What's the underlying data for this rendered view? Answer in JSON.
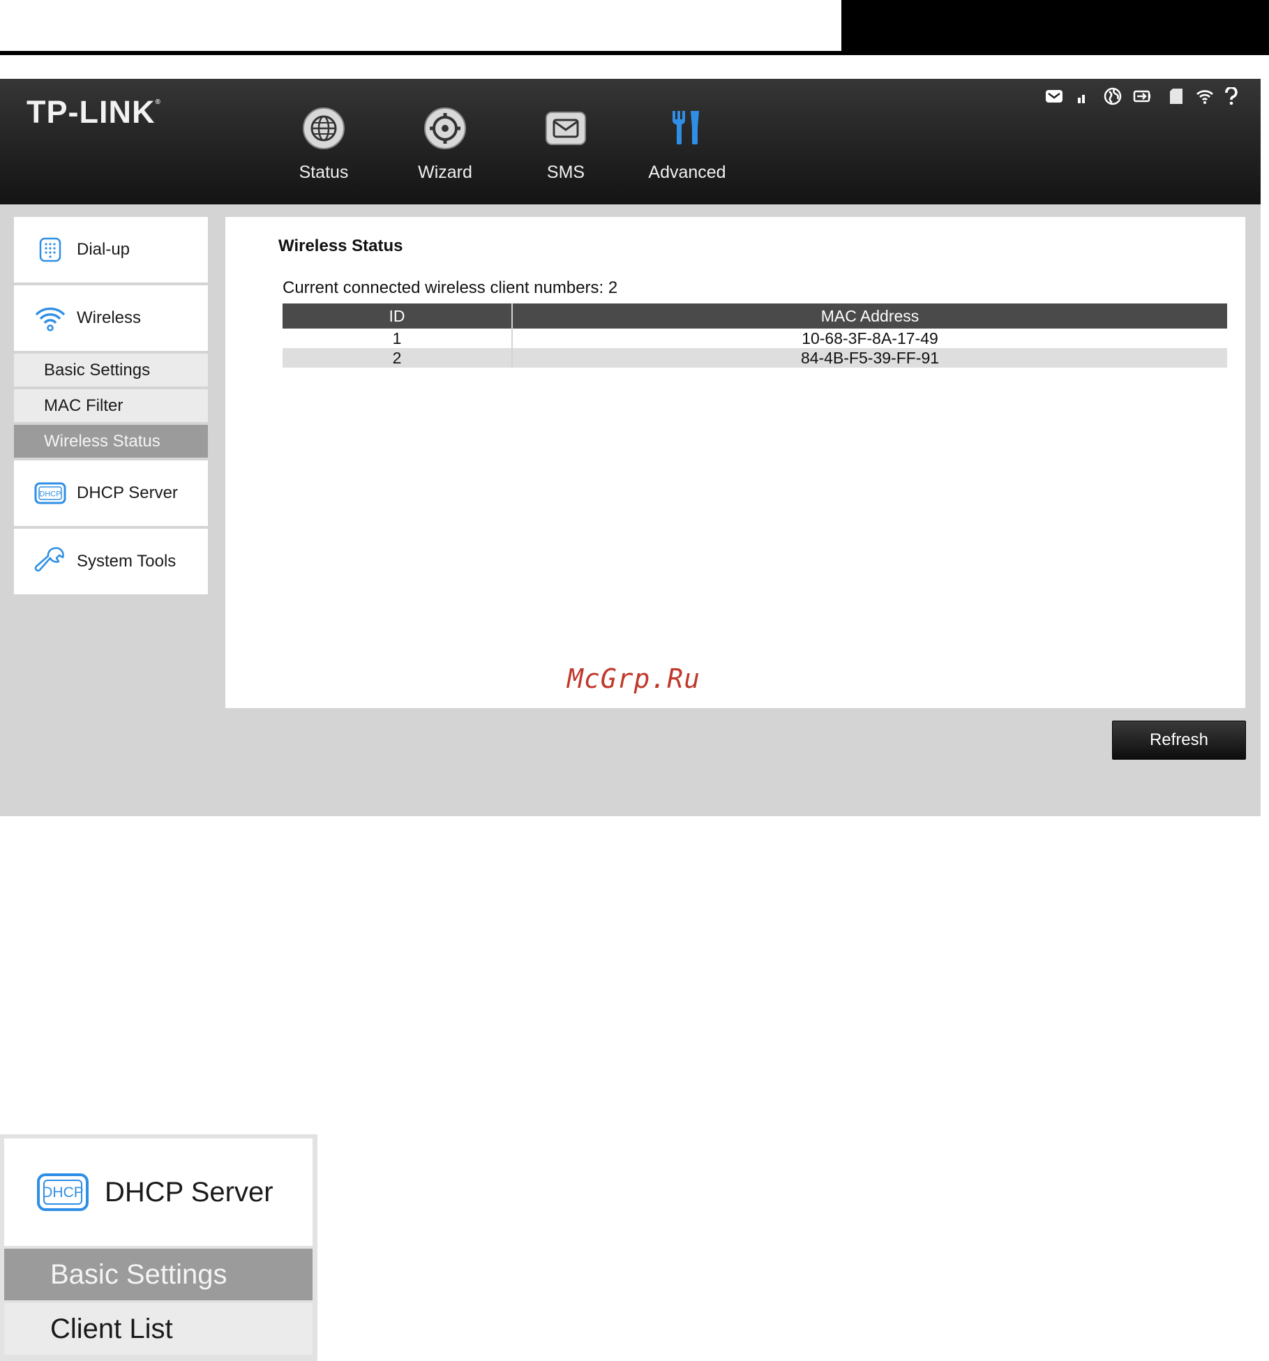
{
  "brand": {
    "logo_text": "TP-LINK",
    "logo_mark": "®"
  },
  "nav": [
    {
      "label": "Status",
      "icon": "globe-icon"
    },
    {
      "label": "Wizard",
      "icon": "gear-icon"
    },
    {
      "label": "SMS",
      "icon": "envelope-icon"
    },
    {
      "label": "Advanced",
      "icon": "tools-icon",
      "active": true
    }
  ],
  "status_icons": [
    "mail-icon",
    "signal-icon",
    "internet-icon",
    "battery-icon",
    "sd-card-icon",
    "wifi-icon",
    "help-icon"
  ],
  "sidebar": {
    "items": [
      {
        "label": "Dial-up",
        "icon": "dialpad-icon"
      },
      {
        "label": "Wireless",
        "icon": "wifi-icon"
      },
      {
        "label": "Basic Settings"
      },
      {
        "label": "MAC Filter"
      },
      {
        "label": "Wireless Status",
        "active": true
      },
      {
        "label": "DHCP Server",
        "icon": "dhcp-icon"
      },
      {
        "label": "System Tools",
        "icon": "wrench-icon"
      }
    ]
  },
  "main": {
    "title": "Wireless Status",
    "client_count_label": "Current connected wireless client numbers:",
    "client_count": "2",
    "table": {
      "headers": [
        "ID",
        "MAC Address"
      ],
      "rows": [
        [
          "1",
          "10-68-3F-8A-17-49"
        ],
        [
          "2",
          "84-4B-F5-39-FF-91"
        ]
      ]
    },
    "refresh_label": "Refresh"
  },
  "watermark": "McGrp.Ru",
  "inset": {
    "dhcp_label": "DHCP Server",
    "dhcp_icon_text": "DHCP",
    "basic_settings_label": "Basic Settings",
    "client_list_label": "Client List"
  },
  "colors": {
    "topbar": "#262626",
    "accent_blue": "#2f8fe6",
    "active_sub": "#9b9b9b",
    "table_header": "#4a4a4a",
    "watermark": "#c0392b"
  }
}
